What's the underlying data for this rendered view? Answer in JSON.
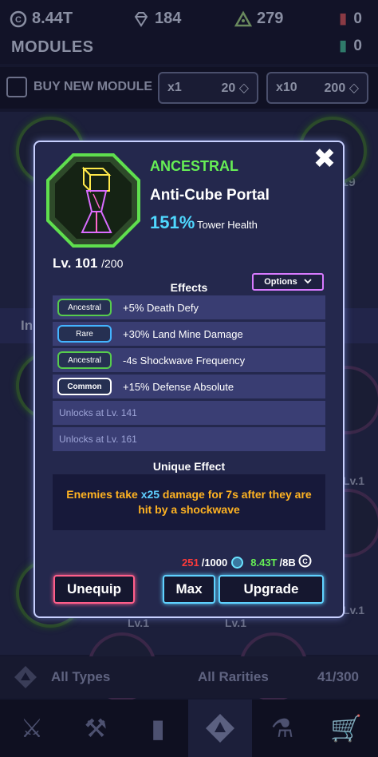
{
  "top_bar": {
    "coins": "8.44T",
    "gems": "184",
    "stones": "279",
    "ticket_a": "0",
    "ticket_b": "0"
  },
  "screen_title": "MODULES",
  "buy_row": {
    "label": "BUY NEW MODULE",
    "x1_label": "x1",
    "x1_price": "20",
    "x10_label": "x10",
    "x10_price": "200"
  },
  "background": {
    "level_label": "Lv.1",
    "partial_number": "19",
    "partial_text": "In"
  },
  "filters": {
    "types": "All Types",
    "rarities": "All Rarities",
    "count": "41/300"
  },
  "modal": {
    "rarity": "ANCESTRAL",
    "name": "Anti-Cube Portal",
    "stat_value": "151%",
    "stat_label": "Tower Health",
    "level": "Lv. 101",
    "level_max": "/200",
    "effects_title": "Effects",
    "options_label": "Options",
    "effects": [
      {
        "rarity": "Ancestral",
        "text": "+5% Death Defy"
      },
      {
        "rarity": "Rare",
        "text": "+30% Land Mine Damage"
      },
      {
        "rarity": "Ancestral",
        "text": "-4s Shockwave Frequency"
      },
      {
        "rarity": "Common",
        "text": "+15% Defense Absolute"
      }
    ],
    "locked": [
      {
        "text": "Unlocks at Lv. 141"
      },
      {
        "text": "Unlocks at Lv. 161"
      }
    ],
    "unique_title": "Unique Effect",
    "unique_pre": "Enemies take ",
    "unique_hl": "x25",
    "unique_post": " damage for 7s after they are hit by a shockwave",
    "cost_shards_have": "251",
    "cost_shards_need": "/1000",
    "cost_coins_have": "8.43T",
    "cost_coins_need": "/8B",
    "unequip_label": "Unequip",
    "max_label": "Max",
    "upgrade_label": "Upgrade"
  },
  "colors": {
    "ancestral": "#66ee55",
    "rare": "#43b4ff",
    "stat": "#4fd8ff",
    "unique_text": "#ffb322",
    "unequip_border": "#ff5e8a"
  },
  "icons": {
    "close": "close-icon",
    "options": "chevron-down-icon",
    "coin": "coin-icon",
    "gem": "gem-icon",
    "stone": "power-stone-icon"
  }
}
